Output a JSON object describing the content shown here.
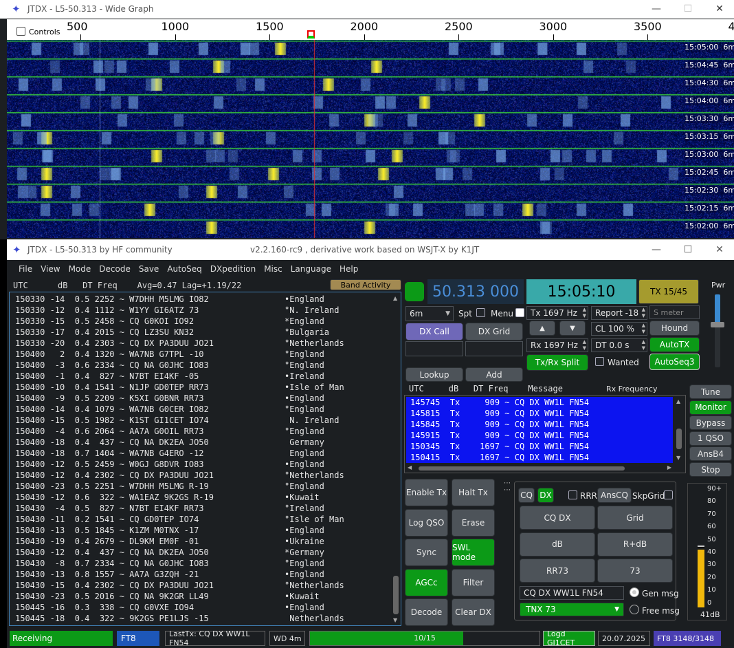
{
  "wide_graph": {
    "title": "JTDX - L5-50.313 - Wide Graph",
    "controls_label": "Controls",
    "freq_ticks": [
      "500",
      "1000",
      "1500",
      "2000",
      "2500",
      "3000",
      "3500",
      "4000"
    ],
    "times": [
      "15:05:00",
      "15:04:45",
      "15:04:30",
      "15:04:00",
      "15:03:30",
      "15:03:15",
      "15:03:00",
      "15:02:45",
      "15:02:30",
      "15:02:15",
      "15:02:00"
    ],
    "band": "6m"
  },
  "main": {
    "title_left": "JTDX - L5-50.313  by HF community",
    "title_right": "v2.2.160-rc9 , derivative work based on WSJT-X by K1JT",
    "menu": [
      "File",
      "View",
      "Mode",
      "Decode",
      "Save",
      "AutoSeq",
      "DXpedition",
      "Misc",
      "Language",
      "Help"
    ],
    "band_header": "UTC      dB   DT Freq    Avg=0.47 Lag=+1.19/22",
    "band_activity_label": "Band Activity",
    "decodes": [
      {
        "t": "150330 -14  0.5 2252 ~ W7DHH M5LMG IO82",
        "c": "•England"
      },
      {
        "t": "150330 -12  0.4 1112 ~ W1YY GI6ATZ 73",
        "c": "°N. Ireland"
      },
      {
        "t": "150330 -15  0.5 2458 ~ CQ G0KOI IO92",
        "c": "*England"
      },
      {
        "t": "150330 -17  0.4 2015 ~ CQ LZ3SU KN32",
        "c": "°Bulgaria"
      },
      {
        "t": "150330 -20  0.4 2303 ~ CQ DX PA3DUU JO21",
        "c": "°Netherlands"
      },
      {
        "t": "150400   2  0.4 1320 ~ WA7NB G7TPL -10",
        "c": "°England"
      },
      {
        "t": "150400  -3  0.6 2334 ~ CQ NA G0JHC IO83",
        "c": "°England"
      },
      {
        "t": "150400  -1  0.4  827 ~ N7BT EI4KF -05",
        "c": "•Ireland"
      },
      {
        "t": "150400 -10  0.4 1541 ~ N1JP GD0TEP RR73",
        "c": "•Isle of Man"
      },
      {
        "t": "150400  -9  0.5 2209 ~ K5XI G0BNR RR73",
        "c": "•England"
      },
      {
        "t": "150400 -14  0.4 1079 ~ WA7NB G0CER IO82",
        "c": "°England"
      },
      {
        "t": "150400 -15  0.5 1982 ~ K1ST GI1CET IO74",
        "c": " N. Ireland"
      },
      {
        "t": "150400  -4  0.6 2064 ~ AA7A G0OIL RR73",
        "c": "°England"
      },
      {
        "t": "150400 -18  0.4  437 ~ CQ NA DK2EA JO50",
        "c": " Germany"
      },
      {
        "t": "150400 -18  0.7 1404 ~ WA7NB G4ERO -12",
        "c": " England"
      },
      {
        "t": "150400 -12  0.5 2459 ~ W0GJ G8DVR IO83",
        "c": "•England"
      },
      {
        "t": "150400 -12  0.4 2302 ~ CQ DX PA3DUU JO21",
        "c": "°Netherlands"
      },
      {
        "t": "150400 -23  0.5 2251 ~ W7DHH M5LMG R-19",
        "c": "°England"
      },
      {
        "t": "150430 -12  0.6  322 ~ WA1EAZ 9K2GS R-19",
        "c": "•Kuwait"
      },
      {
        "t": "150430  -4  0.5  827 ~ N7BT EI4KF RR73",
        "c": "°Ireland"
      },
      {
        "t": "150430 -11  0.2 1541 ~ CQ GD0TEP IO74",
        "c": "°Isle of Man"
      },
      {
        "t": "150430 -13  0.5 1845 ~ K1ZM M0TNX -17",
        "c": "•England"
      },
      {
        "t": "150430 -19  0.4 2679 ~ DL9KM EM0F -01",
        "c": "•Ukraine"
      },
      {
        "t": "150430 -12  0.4  437 ~ CQ NA DK2EA JO50",
        "c": "*Germany"
      },
      {
        "t": "150430  -8  0.7 2334 ~ CQ NA G0JHC IO83",
        "c": "°England"
      },
      {
        "t": "150430 -13  0.8 1557 ~ AA7A G3ZQH -21",
        "c": "•England"
      },
      {
        "t": "150430 -15  0.4 2302 ~ CQ DX PA3DUU JO21",
        "c": "°Netherlands"
      },
      {
        "t": "150430 -23  0.5 2016 ~ CQ NA 9K2GR LL49",
        "c": "•Kuwait"
      },
      {
        "t": "150445 -16  0.3  338 ~ CQ G0VXE IO94",
        "c": "•England"
      },
      {
        "t": "150445 -18  0.4  322 ~ 9K2GS PE1LJS -15",
        "c": " Netherlands"
      }
    ],
    "dial_freq": "50.313 000",
    "utc_clock": "15:05:10",
    "tx_period": "TX 15/45",
    "pwr_label": "Pwr",
    "band_select": "6m",
    "spt_label": "Spt",
    "menu_label": "Menu",
    "tx_hz": "Tx  1697 Hz",
    "rx_hz": "Rx  1697 Hz",
    "report": "Report -18",
    "s_meter": "S meter",
    "cl": "CL  100 %",
    "dt": "DT 0.0 s",
    "dx_call_label": "DX Call",
    "dx_grid_label": "DX Grid",
    "hound_label": "Hound",
    "autotx_label": "AutoTX",
    "autoseq_label": "AutoSeq3",
    "txrx_split_label": "Tx/Rx Split",
    "wanted_label": "Wanted",
    "lookup_label": "Lookup",
    "add_label": "Add",
    "rx_header": "UTC     dB   DT Freq    Message",
    "rx_freq_label": "Rx Frequency",
    "rx_rows": [
      "145745  Tx     909 ~ CQ DX WW1L FN54",
      "145815  Tx     909 ~ CQ DX WW1L FN54",
      "145845  Tx     909 ~ CQ DX WW1L FN54",
      "145915  Tx     909 ~ CQ DX WW1L FN54",
      "150345  Tx    1697 ~ CQ DX WW1L FN54",
      "150415  Tx    1697 ~ CQ DX WW1L FN54"
    ],
    "right_buttons": [
      "Tune",
      "Monitor",
      "Bypass",
      "1 QSO",
      "AnsB4",
      "Stop"
    ],
    "left_buttons": [
      "Enable Tx",
      "Halt Tx",
      "Log QSO",
      "Erase",
      "Sync",
      "SWL mode",
      "AGCc",
      "Filter",
      "Decode",
      "Clear DX"
    ],
    "cq_label": "CQ",
    "dx_label": "DX",
    "rrr_label": "RRR",
    "anscq_label": "AnsCQ",
    "skpgrid_label": "SkpGrid",
    "msg_buttons": [
      "CQ DX",
      "Grid",
      "dB",
      "R+dB",
      "RR73",
      "73"
    ],
    "gen_msg_text": "CQ DX WW1L FN54",
    "gen_msg_label": "Gen msg",
    "tnx_msg": "TNX 73",
    "free_msg_label": "Free msg",
    "meter_ticks": [
      "90+",
      "80",
      "70",
      "60",
      "50",
      "40",
      "30",
      "20",
      "10",
      "0"
    ],
    "meter_db": "41dB",
    "status": {
      "receiving": "Receiving",
      "mode": "FT8",
      "lasttx": "LastTx: CQ DX WW1L FN54",
      "wd": "WD 4m",
      "progress": "10/15",
      "progress_value": 0.667,
      "logd": "Logd GI1CET",
      "date": "20.07.2025",
      "count": "FT8  3148/3148"
    }
  }
}
